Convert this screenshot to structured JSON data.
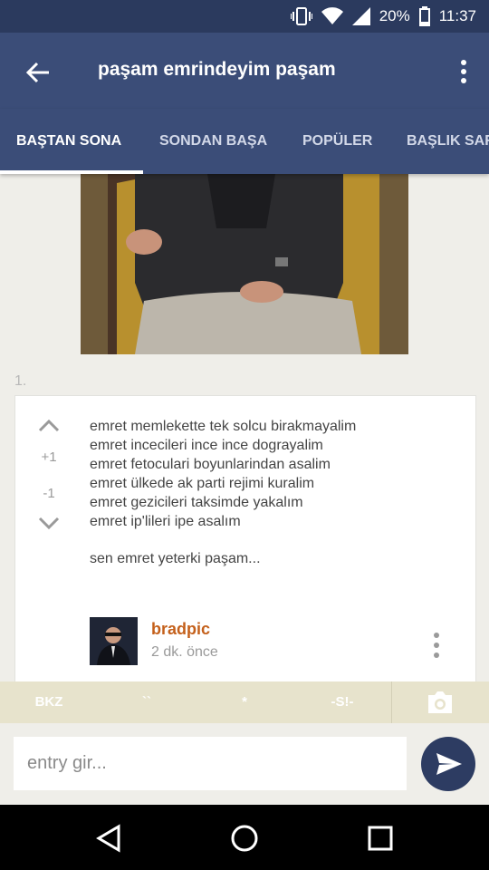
{
  "status_bar": {
    "battery": "20%",
    "time": "11:37"
  },
  "app_bar": {
    "title": "paşam emrindeyim paşam"
  },
  "tabs": [
    {
      "label": "BAŞTAN SONA",
      "active": true
    },
    {
      "label": "SONDAN BAŞA",
      "active": false
    },
    {
      "label": "POPÜLER",
      "active": false
    },
    {
      "label": "BAŞLIK SAR",
      "active": false
    }
  ],
  "entry": {
    "number": "1.",
    "plus": "+1",
    "minus": "-1",
    "lines": [
      "emret memlekette tek solcu birakmayalim",
      "emret incecileri ince ince dograyalim",
      "emret fetoculari boyunlarindan asalim",
      "emret ülkede ak parti rejimi kuralim",
      "emret gezicileri taksimde yakalım",
      "emret ip'lileri ipe asalım"
    ],
    "signoff": "sen emret yeterki paşam...",
    "author": "bradpic",
    "time": "2 dk. önce"
  },
  "toolbar": {
    "bkz": "BKZ",
    "backtick": "``",
    "star": "*",
    "spoiler": "-S!-"
  },
  "composer": {
    "placeholder": "entry gir..."
  },
  "colors": {
    "primary": "#3b4d78",
    "status": "#2b3a5e",
    "author": "#c4601b",
    "toolbar": "#e7e3cc"
  }
}
